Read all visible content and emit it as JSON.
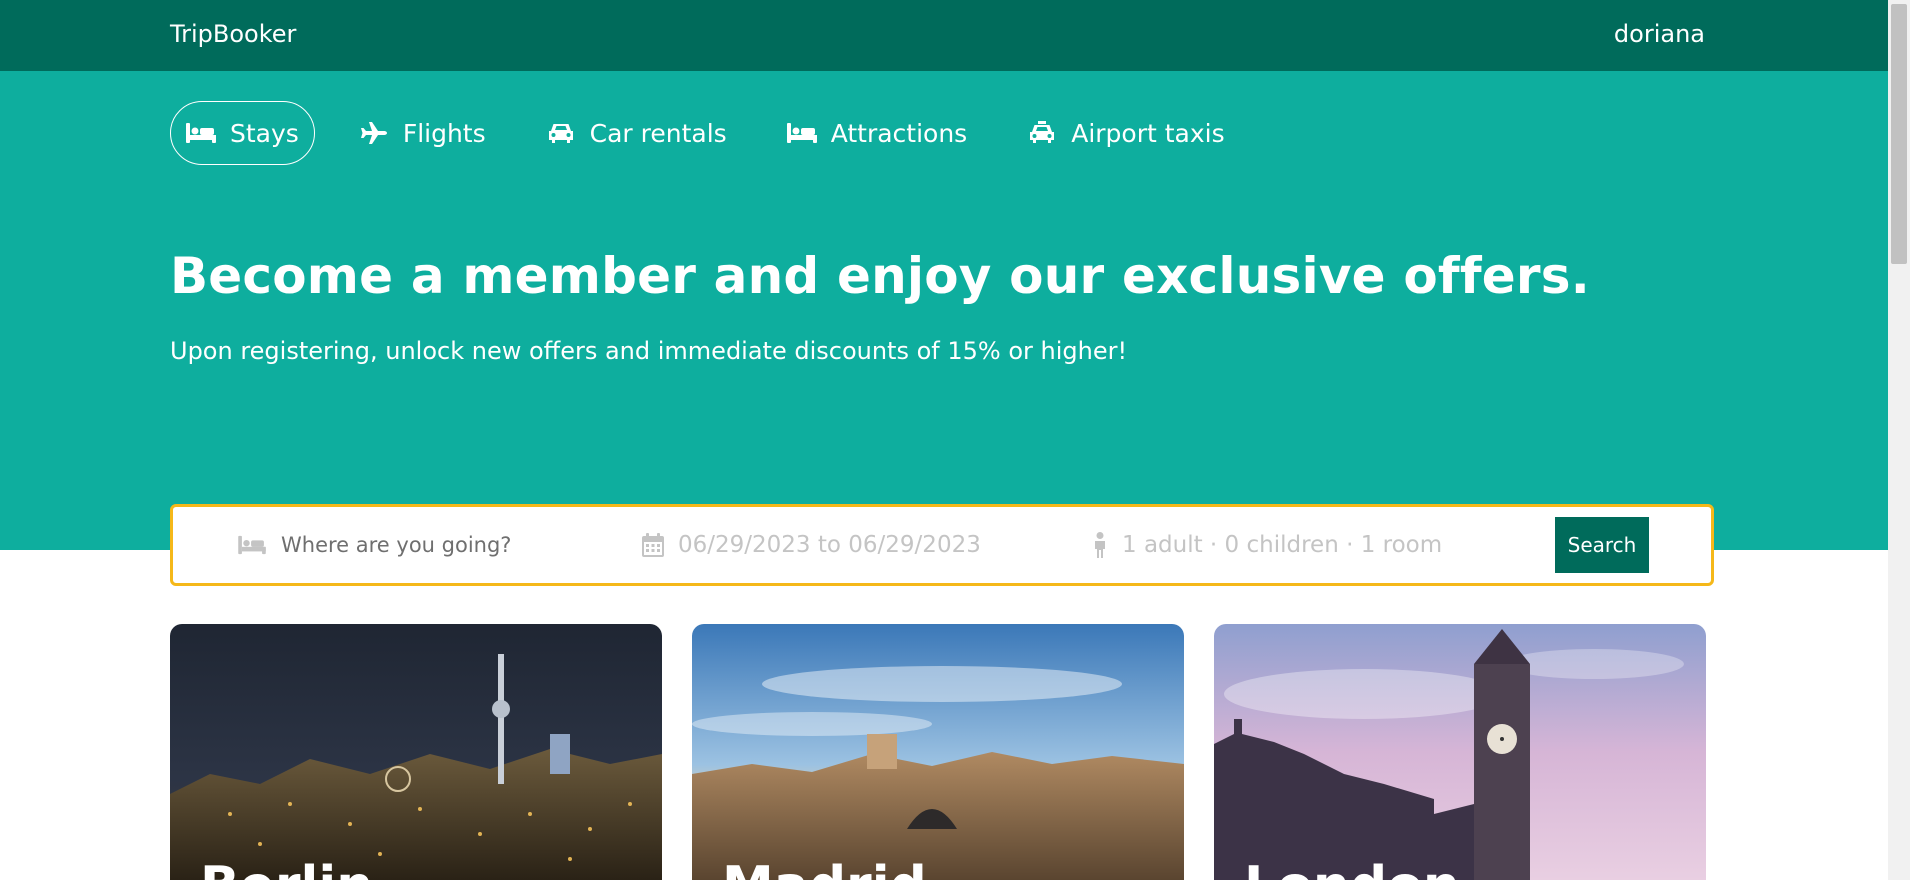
{
  "header": {
    "brand": "TripBooker",
    "user": "doriana"
  },
  "nav": {
    "items": [
      {
        "label": "Stays",
        "icon": "bed-icon",
        "active": true
      },
      {
        "label": "Flights",
        "icon": "plane-icon",
        "active": false
      },
      {
        "label": "Car rentals",
        "icon": "car-icon",
        "active": false
      },
      {
        "label": "Attractions",
        "icon": "bed-icon",
        "active": false
      },
      {
        "label": "Airport taxis",
        "icon": "taxi-icon",
        "active": false
      }
    ]
  },
  "hero": {
    "headline": "Become a member and enjoy our exclusive offers.",
    "subline": "Upon registering, unlock new offers and immediate discounts of 15% or higher!"
  },
  "search": {
    "destination_placeholder": "Where are you going?",
    "dates": "06/29/2023 to 06/29/2023",
    "guests": "1 adult · 0 children · 1 room",
    "button_label": "Search"
  },
  "cards": [
    {
      "title": "Berlin"
    },
    {
      "title": "Madrid"
    },
    {
      "title": "London"
    }
  ],
  "colors": {
    "topbar": "#006b5b",
    "hero": "#0eae9e",
    "search_border": "#f5b819",
    "search_button": "#006b5b"
  }
}
